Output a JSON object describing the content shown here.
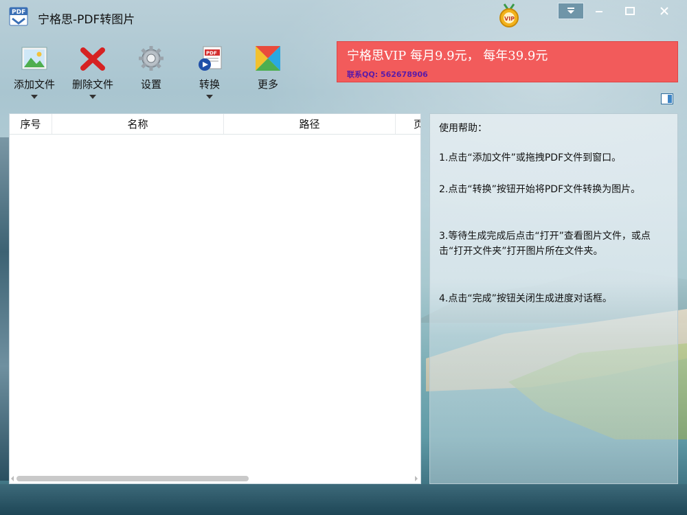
{
  "window": {
    "title": "宁格思-PDF转图片",
    "controls": [
      "menu-dropdown",
      "minimize",
      "maximize",
      "close"
    ]
  },
  "toolbar": {
    "items": [
      {
        "label": "添加文件",
        "icon": "image-add-icon",
        "dropdown": true
      },
      {
        "label": "删除文件",
        "icon": "delete-x-icon",
        "dropdown": true
      },
      {
        "label": "设置",
        "icon": "gear-icon",
        "dropdown": false
      },
      {
        "label": "转换",
        "icon": "pdf-convert-icon",
        "dropdown": true
      },
      {
        "label": "更多",
        "icon": "more-grid-icon",
        "dropdown": false
      }
    ]
  },
  "banner": {
    "text": "宁格思VIP 每月9.9元， 每年39.9元",
    "qq": "联系QQ: 562678906",
    "color": "#f25b5b"
  },
  "file_list": {
    "columns": [
      "序号",
      "名称",
      "路径",
      "页"
    ],
    "rows": []
  },
  "help": {
    "title": "使用帮助：",
    "steps": [
      " 1.点击“添加文件”或拖拽PDF文件到窗口。",
      " 2.点击“转换”按钮开始将PDF文件转换为图片。",
      " 3.等待生成完成后点击“打开”查看图片文件，或点击“打开文件夹”打开图片所在文件夹。",
      " 4.点击“完成”按钮关闭生成进度对话框。"
    ]
  }
}
